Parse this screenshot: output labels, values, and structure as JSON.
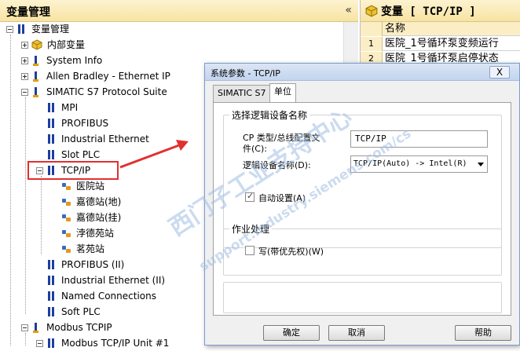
{
  "left_panel": {
    "title": "变量管理",
    "collapse_glyph": "«",
    "tree": {
      "root": "变量管理",
      "internal": "内部变量",
      "system_info": "System Info",
      "ab": "Allen Bradley - Ethernet IP",
      "s7": "SIMATIC S7 Protocol Suite",
      "mpi": "MPI",
      "profibus": "PROFIBUS",
      "ind_eth": "Industrial Ethernet",
      "slot_plc": "Slot PLC",
      "tcpip": "TCP/IP",
      "stations": [
        "医院站",
        "嘉德站(地)",
        "嘉德站(挂)",
        "浡德苑站",
        "茗苑站"
      ],
      "profibus2": "PROFIBUS (II)",
      "ind_eth2": "Industrial Ethernet (II)",
      "named": "Named Connections",
      "soft_plc": "Soft PLC",
      "modbus": "Modbus TCPIP",
      "modbus_unit": "Modbus TCP/IP Unit #1"
    }
  },
  "right_panel": {
    "title": "变量 [ TCP/IP ]",
    "column_header": "名称",
    "rows": [
      {
        "idx": "1",
        "name": "医院_1号循环泵变频运行"
      },
      {
        "idx": "2",
        "name": "医院_1号循环泵启停状态"
      }
    ]
  },
  "dialog": {
    "title": "系统参数 - TCP/IP",
    "close_glyph": "X",
    "tabs": [
      "SIMATIC S7",
      "单位"
    ],
    "group1_title": "选择逻辑设备名称",
    "cp_label_line1": "CP 类型/总线配置文",
    "cp_label_line2": "件(C):",
    "cp_value": "TCP/IP",
    "logical_label": "逻辑设备名称(D):",
    "logical_value": "TCP/IP(Auto) -> Intel(R)",
    "auto_setting": "自动设置(A)",
    "group2_title": "作业处理",
    "write_priority": "写(带优先权)(W)",
    "buttons": {
      "ok": "确定",
      "cancel": "取消",
      "help": "帮助"
    }
  },
  "watermark": {
    "main": "西门子工业支持中心",
    "sub": "support.industry.siemens.com/cs"
  },
  "colors": {
    "highlight": "#e1302f",
    "header_bg": "#f7e3a2",
    "dialog_border": "#7a9ccf"
  }
}
